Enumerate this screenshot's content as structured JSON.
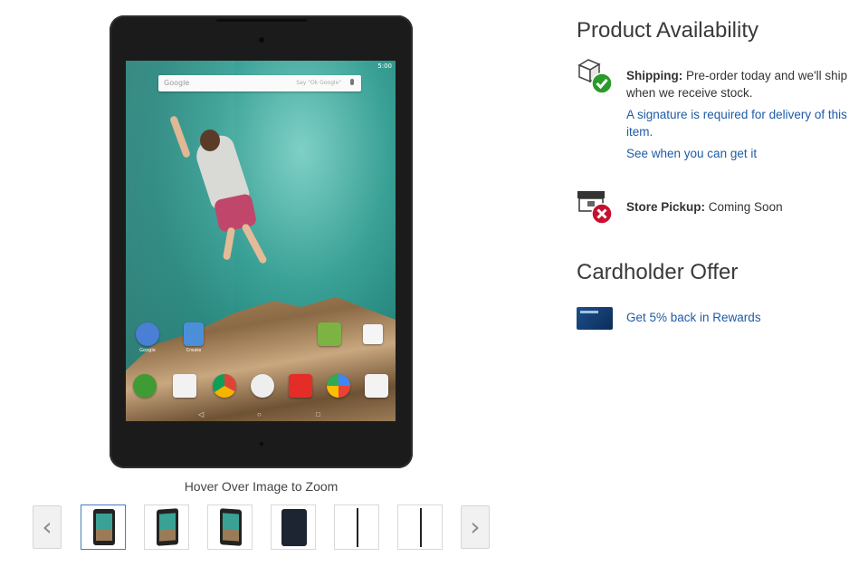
{
  "gallery": {
    "zoom_hint": "Hover Over Image to Zoom",
    "prev_arrow": "‹",
    "next_arrow": "›",
    "thumbnails": [
      {
        "name": "front-screen",
        "selected": true
      },
      {
        "name": "angled-screen-left",
        "selected": false
      },
      {
        "name": "angled-screen-right",
        "selected": false
      },
      {
        "name": "back-view",
        "selected": false
      },
      {
        "name": "side-edge-1",
        "selected": false
      },
      {
        "name": "side-edge-2",
        "selected": false
      }
    ]
  },
  "device_screen": {
    "search_logo": "Google",
    "search_hint": "Say \"Ok Google\"",
    "status_time": "5:00",
    "apps_row1": [
      {
        "label": "Google",
        "color": "#4a7fd6"
      },
      {
        "label": "Create",
        "color": "#4b8fd9"
      }
    ]
  },
  "availability": {
    "heading": "Product Availability",
    "shipping_label": "Shipping:",
    "shipping_text": " Pre-order today and we'll ship when we receive stock.",
    "signature_link": "A signature is required for delivery of this item.",
    "see_when_link": "See when you can get it",
    "pickup_label": "Store Pickup:",
    "pickup_text": " Coming Soon",
    "colors": {
      "ok": "#2a9a2a",
      "error": "#c8102e",
      "link": "#1f5ba6"
    }
  },
  "offer": {
    "heading": "Cardholder Offer",
    "rewards_link": "Get 5% back in Rewards"
  }
}
